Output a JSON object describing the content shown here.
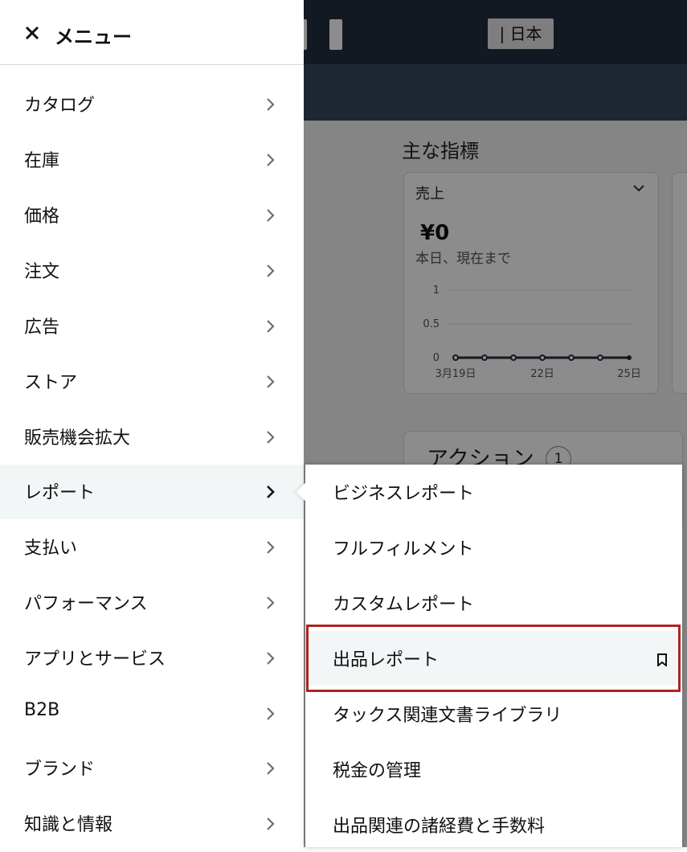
{
  "background": {
    "region_label": "| 日本",
    "kpi": {
      "section_title": "主な指標",
      "card_label": "売上",
      "value": "¥0",
      "subtitle": "本日、現在まで",
      "y_ticks": [
        "1",
        "0.5",
        "0"
      ],
      "x_ticks": [
        "3月19日",
        "22日",
        "25日"
      ]
    },
    "actions": {
      "title": "アクション",
      "count": "1"
    }
  },
  "menu": {
    "title": "メニュー",
    "items": [
      {
        "label": "カタログ"
      },
      {
        "label": "在庫"
      },
      {
        "label": "価格"
      },
      {
        "label": "注文"
      },
      {
        "label": "広告"
      },
      {
        "label": "ストア"
      },
      {
        "label": "販売機会拡大"
      },
      {
        "label": "レポート"
      },
      {
        "label": "支払い"
      },
      {
        "label": "パフォーマンス"
      },
      {
        "label": "アプリとサービス"
      },
      {
        "label": "B2B"
      },
      {
        "label": "ブランド"
      },
      {
        "label": "知識と情報"
      }
    ],
    "active_item": "レポート"
  },
  "submenu": {
    "items": [
      {
        "label": "ビジネスレポート"
      },
      {
        "label": "フルフィルメント"
      },
      {
        "label": "カスタムレポート"
      },
      {
        "label": "出品レポート"
      },
      {
        "label": "タックス関連文書ライブラリ"
      },
      {
        "label": "税金の管理"
      },
      {
        "label": "出品関連の諸経費と手数料"
      }
    ],
    "highlighted_item": "出品レポート"
  },
  "colors": {
    "highlight_border": "#b22222",
    "active_bg": "#f2f6f6",
    "overlay": "rgba(0,0,0,0.45)"
  }
}
